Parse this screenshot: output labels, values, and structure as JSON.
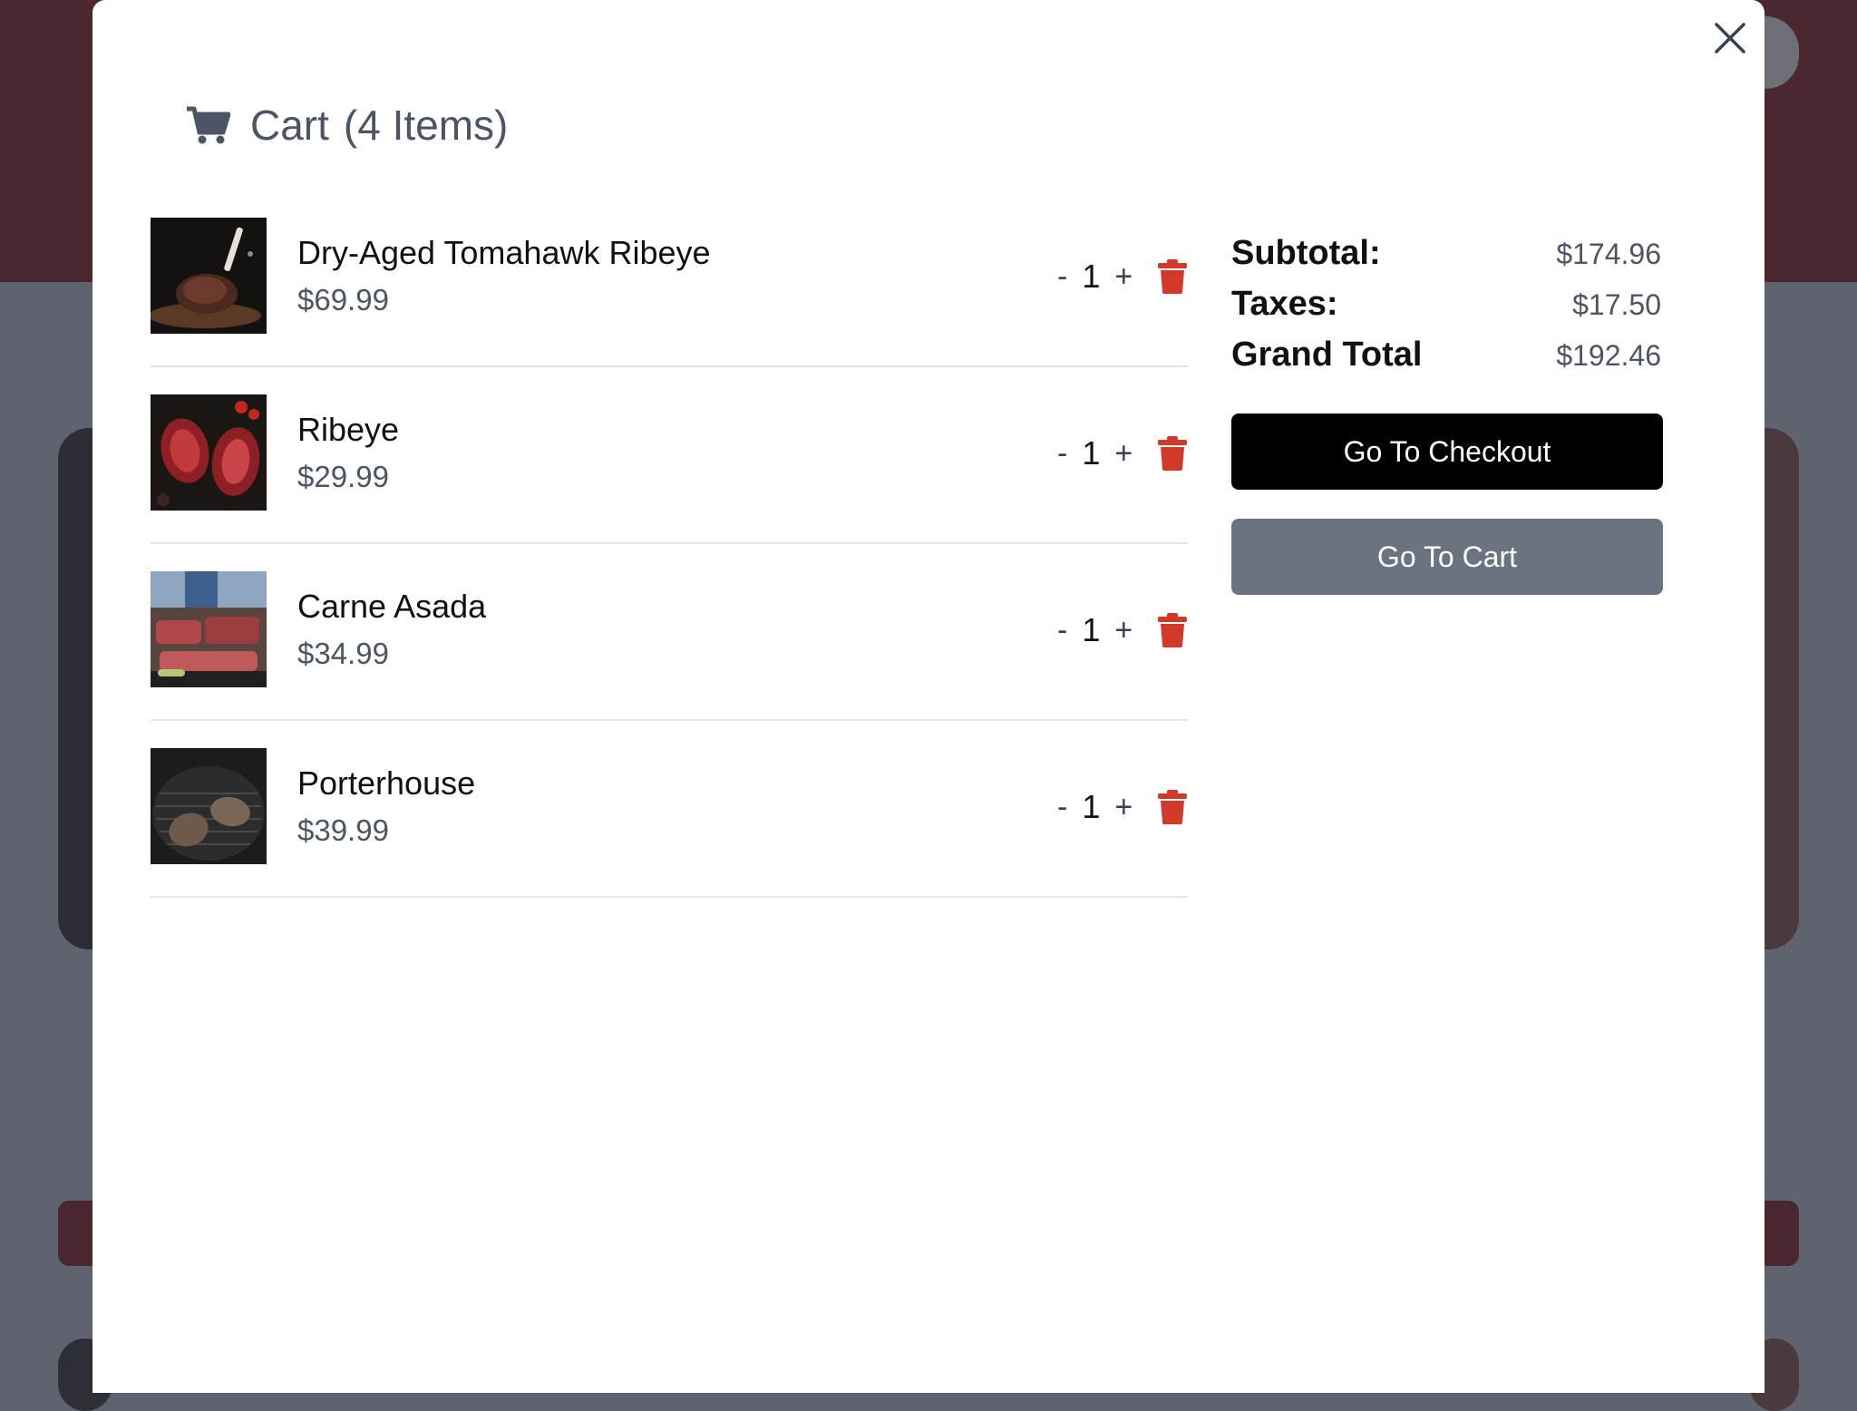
{
  "cart": {
    "title": "Cart",
    "count_label": "(4 Items)",
    "items": [
      {
        "name": "Dry-Aged Tomahawk Ribeye",
        "price": "$69.99",
        "quantity": "1",
        "image": "tomahawk-steak-photo"
      },
      {
        "name": "Ribeye",
        "price": "$29.99",
        "quantity": "1",
        "image": "raw-ribeye-photo"
      },
      {
        "name": "Carne Asada",
        "price": "$34.99",
        "quantity": "1",
        "image": "carne-asada-grill-photo"
      },
      {
        "name": "Porterhouse",
        "price": "$39.99",
        "quantity": "1",
        "image": "porterhouse-grill-photo"
      }
    ],
    "qty_decrement": "-",
    "qty_increment": "+"
  },
  "summary": {
    "subtotal_label": "Subtotal:",
    "subtotal_value": "$174.96",
    "taxes_label": "Taxes:",
    "taxes_value": "$17.50",
    "grand_total_label": "Grand Total",
    "grand_total_value": "$192.46"
  },
  "actions": {
    "checkout_label": "Go To Checkout",
    "cart_label": "Go To Cart"
  },
  "colors": {
    "accent_delete": "#d1392b",
    "checkout_bg": "#000000",
    "cart_button_bg": "#6b7280",
    "backdrop_header": "#4b2730"
  }
}
